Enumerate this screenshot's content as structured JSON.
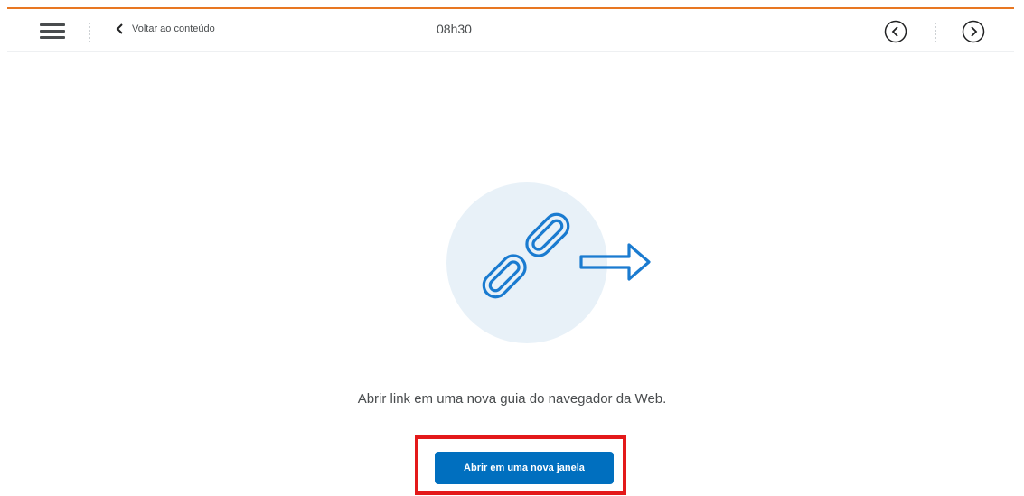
{
  "header": {
    "back_label": "Voltar ao conteúdo",
    "time": "08h30"
  },
  "icons": {
    "menu": "hamburger-menu-icon",
    "back": "chevron-left-icon",
    "prev": "circle-arrow-left-icon",
    "next": "circle-arrow-right-icon",
    "illustration": "chain-link-arrow-icon"
  },
  "main": {
    "caption": "Abrir link em uma nova guia do navegador da Web.",
    "button_label": "Abrir em uma nova janela"
  },
  "colors": {
    "accent": "#e87722",
    "primary_button": "#006fbf",
    "highlight": "#e3191a",
    "illustration_bg": "#e8f1f8",
    "illustration_stroke": "#1a7bd0"
  }
}
